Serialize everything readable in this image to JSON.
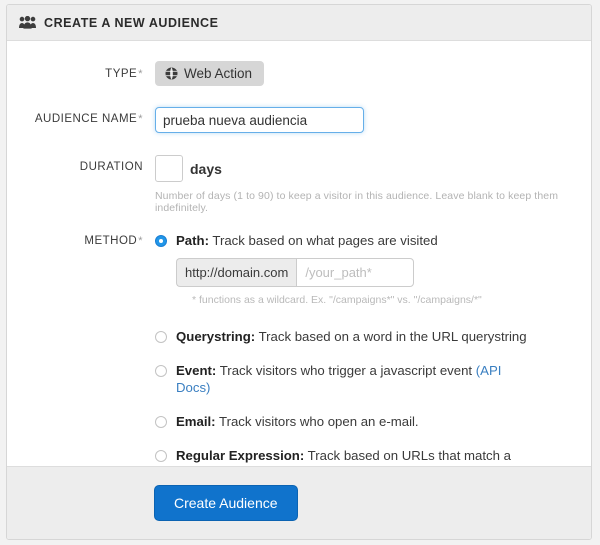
{
  "panel": {
    "title": "CREATE A NEW AUDIENCE",
    "header_icon": "users-icon"
  },
  "form": {
    "type": {
      "label": "TYPE",
      "required_marker": "*",
      "badge_label": "Web Action",
      "badge_icon": "globe-icon"
    },
    "audience_name": {
      "label": "AUDIENCE NAME",
      "required_marker": "*",
      "value": "prueba nueva audiencia",
      "placeholder": ""
    },
    "duration": {
      "label": "DURATION",
      "value": "",
      "placeholder": "",
      "unit": "days",
      "help": "Number of days (1 to 90) to keep a visitor in this audience. Leave blank to keep them indefinitely."
    },
    "method": {
      "label": "METHOD",
      "required_marker": "*",
      "options": [
        {
          "id": "path",
          "title": "Path:",
          "description": " Track based on what pages are visited",
          "selected": true
        },
        {
          "id": "querystring",
          "title": "Querystring:",
          "description": " Track based on a word in the URL querystring",
          "selected": false
        },
        {
          "id": "event",
          "title": "Event:",
          "description": " Track visitors who trigger a javascript event ",
          "link_text": "(API Docs)",
          "selected": false
        },
        {
          "id": "email",
          "title": "Email:",
          "description": " Track visitors who open an e-mail.",
          "selected": false
        },
        {
          "id": "regex",
          "title": "Regular Expression:",
          "description": " Track based on URLs that match a regular expression (Advanced only).",
          "selected": false
        }
      ],
      "path_input": {
        "addon": "http://domain.com",
        "value": "",
        "placeholder": "/your_path*",
        "help": "* functions as a wildcard. Ex. \"/campaigns*\" vs. \"/campaigns/*\""
      }
    }
  },
  "footer": {
    "submit_label": "Create Audience"
  },
  "colors": {
    "accent": "#1073cc",
    "link": "#3a7fc1",
    "radio_selected": "#2196e8",
    "panel_header_bg": "#ededed"
  }
}
